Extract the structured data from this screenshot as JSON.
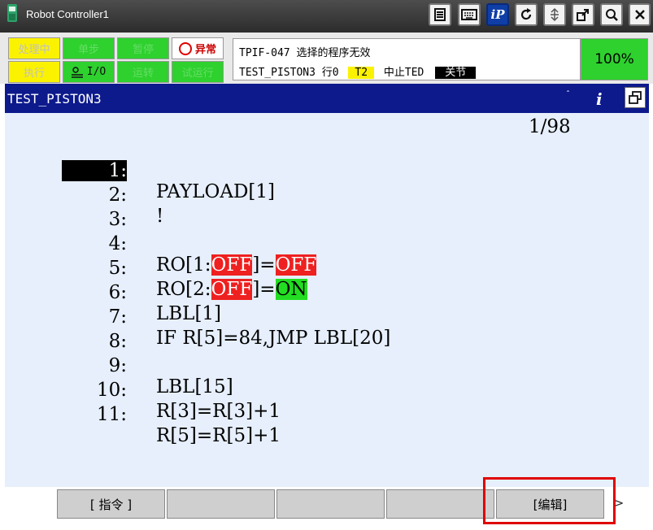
{
  "window": {
    "title": "Robot Controller1"
  },
  "status": {
    "row1": [
      "处理中",
      "单步",
      "暂停",
      "异常"
    ],
    "row2": [
      "执行",
      "I/O",
      "运转",
      "试运行"
    ],
    "message_line1": "TPIF-047 选择的程序无效",
    "msg_program": "TEST_PISTON3",
    "msg_row": "行0",
    "msg_mode": "T2",
    "msg_state": "中止TED",
    "msg_joint": "关节",
    "speed_override": "100%"
  },
  "program_bar": {
    "name": "TEST_PISTON3",
    "info_label": "i"
  },
  "editor": {
    "line_counter": "1/98",
    "lines": [
      {
        "num": "1:",
        "text": "PAYLOAD[1]"
      },
      {
        "num": "2:",
        "text": "!"
      },
      {
        "num": "3:",
        "text": ""
      },
      {
        "num": "4:",
        "pre": "RO[1:",
        "hl1": "OFF",
        "mid": "]=",
        "hl2": "OFF",
        "post": ""
      },
      {
        "num": "5:",
        "pre": "RO[2:",
        "hl1": "OFF",
        "mid": "]=",
        "hl2": "ON",
        "post": ""
      },
      {
        "num": "6:",
        "text": "LBL[1]"
      },
      {
        "num": "7:",
        "text": "IF R[5]=84,JMP LBL[20]"
      },
      {
        "num": "8:",
        "text": ""
      },
      {
        "num": "9:",
        "text": "LBL[15]"
      },
      {
        "num": "10:",
        "text": "R[3]=R[3]+1"
      },
      {
        "num": "11:",
        "text": "R[5]=R[5]+1"
      }
    ]
  },
  "function_keys": {
    "f1": "[ 指令 ]",
    "f2": "",
    "f3": "",
    "f4": "",
    "f5": "[编辑]",
    "next": ">"
  },
  "colors": {
    "title_bg": "#3a3a3a",
    "program_bar": "#0d1a8c",
    "editor_bg": "#e6effb",
    "status_yellow": "#fbf200",
    "status_green": "#2ed12e",
    "highlight_red": "#ee2020",
    "highlight_green": "#22dd22"
  },
  "toolbar_icons": [
    "menu-icon",
    "keyboard-icon",
    "ip-icon",
    "refresh-icon",
    "axes-icon",
    "external-window-icon",
    "help-icon",
    "close-icon"
  ]
}
